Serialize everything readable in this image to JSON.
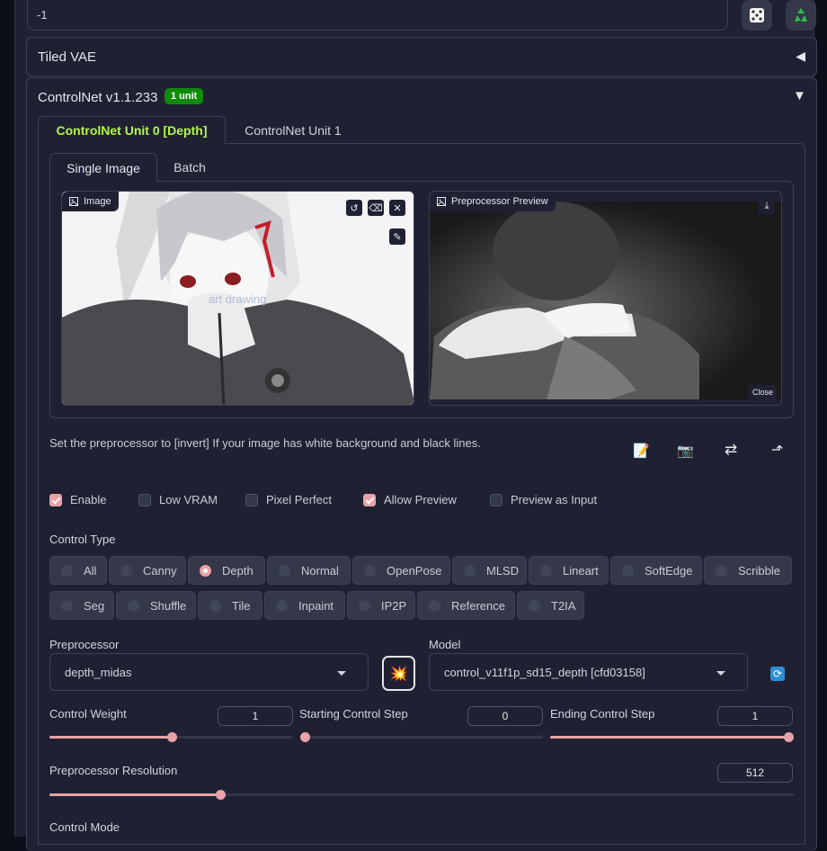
{
  "seed": {
    "value": "-1"
  },
  "seed_buttons": {
    "dice_icon": "dice-icon",
    "recycle_icon": "recycle-icon"
  },
  "tiled_vae": {
    "title": "Tiled VAE",
    "toggle": "◀"
  },
  "controlnet": {
    "title": "ControlNet v1.1.233",
    "badge": "1 unit",
    "toggle": "▼",
    "unit_tabs": [
      "ControlNet Unit 0 [Depth]",
      "ControlNet Unit 1"
    ],
    "image_tabs": [
      "Single Image",
      "Batch"
    ],
    "image_label": "Image",
    "overlay_text": "art drawing",
    "preview_label": "Preprocessor Preview",
    "preview_close": "Close",
    "hint": "Set the preprocessor to [invert] If your image has white background and black lines.",
    "checkboxes": [
      {
        "label": "Enable",
        "checked": true
      },
      {
        "label": "Low VRAM",
        "checked": false
      },
      {
        "label": "Pixel Perfect",
        "checked": false
      },
      {
        "label": "Allow Preview",
        "checked": true
      },
      {
        "label": "Preview as Input",
        "checked": false
      }
    ],
    "control_type_label": "Control Type",
    "control_types_row1": [
      "All",
      "Canny",
      "Depth",
      "Normal",
      "OpenPose",
      "MLSD",
      "Lineart",
      "SoftEdge",
      "Scribble"
    ],
    "control_types_row2": [
      "Seg",
      "Shuffle",
      "Tile",
      "Inpaint",
      "IP2P",
      "Reference",
      "T2IA"
    ],
    "control_type_selected": "Depth",
    "preprocessor_label": "Preprocessor",
    "preprocessor_value": "depth_midas",
    "model_label": "Model",
    "model_value": "control_v11f1p_sd15_depth [cfd03158]",
    "sliders": {
      "control_weight": {
        "label": "Control Weight",
        "value": "1",
        "fraction": 0.5
      },
      "starting_step": {
        "label": "Starting Control Step",
        "value": "0",
        "fraction": 0.0
      },
      "ending_step": {
        "label": "Ending Control Step",
        "value": "1",
        "fraction": 1.0
      },
      "resolution": {
        "label": "Preprocessor Resolution",
        "value": "512",
        "fraction": 0.23
      }
    },
    "control_mode_label": "Control Mode"
  },
  "colors": {
    "accent": "#e8a2a6",
    "badge": "#108a08",
    "active_tab": "#b5f54a",
    "panel": "#1f2133",
    "background": "#0c0f1a"
  }
}
